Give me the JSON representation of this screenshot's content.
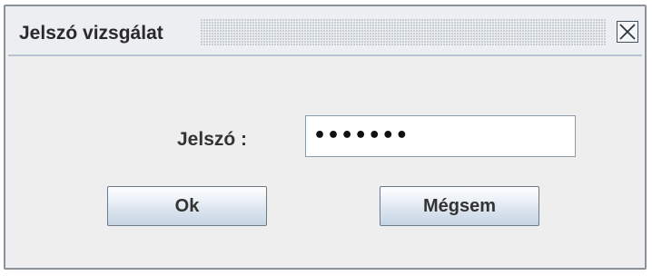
{
  "window": {
    "title": "Jelszó vizsgálat",
    "close_icon": "close-icon"
  },
  "form": {
    "password_label": "Jelszó :",
    "password_value": "•••••••"
  },
  "buttons": {
    "ok_label": "Ok",
    "cancel_label": "Mégsem"
  },
  "colors": {
    "dialog_background": "#eeeeee",
    "button_gradient_top": "#ffffff",
    "button_gradient_bottom": "#c5d3e2",
    "border": "#8a939c"
  }
}
